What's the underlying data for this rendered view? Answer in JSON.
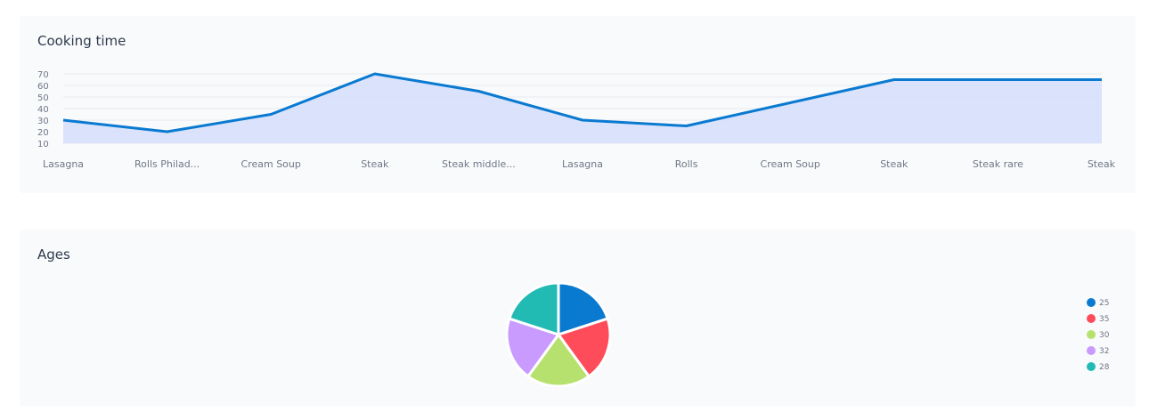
{
  "cards": {
    "cooking_title": "Cooking time",
    "ages_title": "Ages"
  },
  "chart_data": [
    {
      "type": "area",
      "title": "Cooking time",
      "categories": [
        "Lasagna",
        "Rolls Philad...",
        "Cream Soup",
        "Steak",
        "Steak middle...",
        "Lasagna",
        "Rolls",
        "Cream Soup",
        "Steak",
        "Steak rare",
        "Steak"
      ],
      "values": [
        30,
        20,
        35,
        70,
        55,
        30,
        25,
        45,
        65,
        65,
        65
      ],
      "yticks": [
        10,
        20,
        30,
        40,
        50,
        60,
        70
      ],
      "ylim": [
        10,
        70
      ],
      "grid": true,
      "colors": {
        "line": "#0a7ad1",
        "fill": "#d6e0fb"
      }
    },
    {
      "type": "pie",
      "title": "Ages",
      "labels": [
        "25",
        "35",
        "30",
        "32",
        "28"
      ],
      "values": [
        1,
        1,
        1,
        1,
        1
      ],
      "legend": "right",
      "colors": [
        "#0a7ad1",
        "#ff4c5a",
        "#b7e16f",
        "#c99bff",
        "#21bbb4"
      ]
    }
  ]
}
